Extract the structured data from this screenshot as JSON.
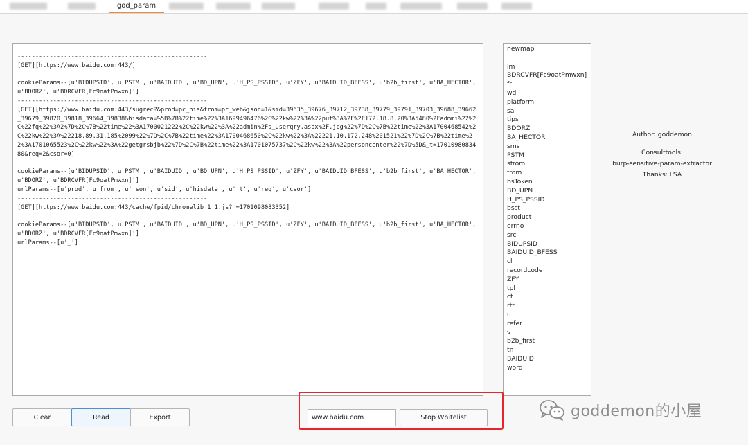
{
  "tabs": {
    "active_label": "god_param"
  },
  "log": {
    "text": "-----------------------------------------------------\n[GET][https://www.baidu.com:443/]\n\ncookieParams--[u'BIDUPSID', u'PSTM', u'BAIDUID', u'BD_UPN', u'H_PS_PSSID', u'ZFY', u'BAIDUID_BFESS', u'b2b_first', u'BA_HECTOR', u'BDORZ', u'BDRCVFR[Fc9oatPmwxn]']\n-----------------------------------------------------\n[GET][https://www.baidu.com:443/sugrec?&prod=pc_his&from=pc_web&json=1&sid=39635_39676_39712_39738_39779_39791_39703_39688_39662_39679_39820_39818_39664_39838&hisdata=%5B%7B%22time%22%3A1699496476%2C%22kw%22%3A%22put%3A%2F%2F172.18.8.20%3A5480%2Fadmmi%22%2C%22fq%22%3A2%7D%2C%7B%22time%22%3A1700021222%2C%22kw%22%3A%22admin%2Fs_userqry.aspx%2F.jpg%22%7D%2C%7B%22time%22%3A1700468542%2C%22kw%22%3A%22218.89.31.185%2099%22%7D%2C%7B%22time%22%3A1700468650%2C%22kw%22%3A%22221.10.172.248%201521%22%7D%2C%7B%22time%22%3A1701065523%2C%22kw%22%3A%22getgrsbjb%22%7D%2C%7B%22time%22%3A1701075737%2C%22kw%22%3A%22personcenter%22%7D%5D&_t=1701098083480&req=2&csor=0]\n\ncookieParams--[u'BIDUPSID', u'PSTM', u'BAIDUID', u'BD_UPN', u'H_PS_PSSID', u'ZFY', u'BAIDUID_BFESS', u'b2b_first', u'BA_HECTOR', u'BDORZ', u'BDRCVFR[Fc9oatPmwxn]']\nurlParams--[u'prod', u'from', u'json', u'sid', u'hisdata', u'_t', u'req', u'csor']\n-----------------------------------------------------\n[GET][https://www.baidu.com:443/cache/fpid/chromelib_1_1.js?_=1701098083352]\n\ncookieParams--[u'BIDUPSID', u'PSTM', u'BAIDUID', u'BD_UPN', u'H_PS_PSSID', u'ZFY', u'BAIDUID_BFESS', u'b2b_first', u'BA_HECTOR', u'BDORZ', u'BDRCVFR[Fc9oatPmwxn]']\nurlParams--[u'_']"
  },
  "params": [
    "newmap",
    "",
    "lm",
    "BDRCVFR[Fc9oatPmwxn]",
    "fr",
    "wd",
    "platform",
    "sa",
    "tips",
    "BDORZ",
    "BA_HECTOR",
    "sms",
    "PSTM",
    "sfrom",
    "from",
    "bsToken",
    "BD_UPN",
    "H_PS_PSSID",
    "bsst",
    "product",
    "errno",
    "src",
    "BIDUPSID",
    "BAIDUID_BFESS",
    "cl",
    "recordcode",
    "ZFY",
    "tpl",
    "ct",
    "rtt",
    "u",
    "refer",
    "v",
    "b2b_first",
    "tn",
    "BAIDUID",
    "word"
  ],
  "credits": {
    "author": "Author: goddemon",
    "consult": "Consulttools:",
    "tool": "burp-sensitive-param-extractor",
    "thanks": "Thanks: LSA"
  },
  "buttons": {
    "clear": "Clear",
    "read": "Read",
    "export": "Export",
    "stop_whitelist": "Stop Whitelist"
  },
  "whitelist": {
    "value": "www.baidu.com"
  },
  "watermark": {
    "text": "goddemon的小屋",
    "icon": "wechat-icon"
  },
  "colors": {
    "highlight": "#e8242f",
    "active_tab_underline": "#f08a3a"
  }
}
